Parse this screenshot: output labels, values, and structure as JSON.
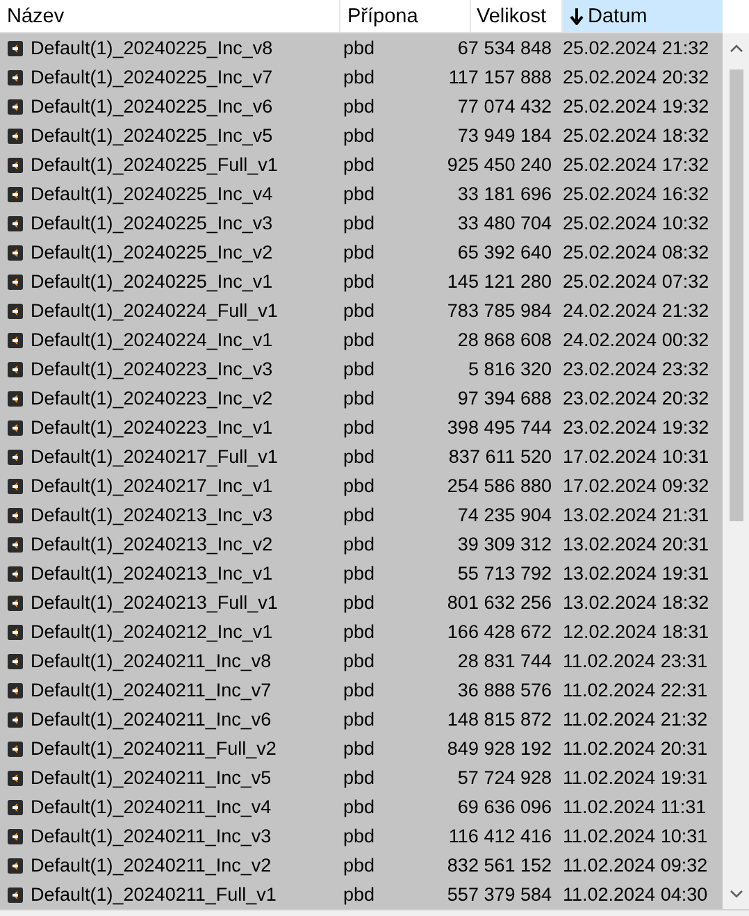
{
  "table": {
    "columns": [
      {
        "label": "Název",
        "sorted": false
      },
      {
        "label": "Přípona",
        "sorted": false
      },
      {
        "label": "Velikost",
        "sorted": false
      },
      {
        "label": "Datum",
        "sorted": true
      }
    ],
    "rows": [
      {
        "name": "Default(1)_20240225_Inc_v8",
        "ext": "pbd",
        "size": "67 534 848",
        "date": "25.02.2024 21:32",
        "selected": true
      },
      {
        "name": "Default(1)_20240225_Inc_v7",
        "ext": "pbd",
        "size": "117 157 888",
        "date": "25.02.2024 20:32",
        "selected": true
      },
      {
        "name": "Default(1)_20240225_Inc_v6",
        "ext": "pbd",
        "size": "77 074 432",
        "date": "25.02.2024 19:32",
        "selected": true
      },
      {
        "name": "Default(1)_20240225_Inc_v5",
        "ext": "pbd",
        "size": "73 949 184",
        "date": "25.02.2024 18:32",
        "selected": true
      },
      {
        "name": "Default(1)_20240225_Full_v1",
        "ext": "pbd",
        "size": "925 450 240",
        "date": "25.02.2024 17:32",
        "selected": true
      },
      {
        "name": "Default(1)_20240225_Inc_v4",
        "ext": "pbd",
        "size": "33 181 696",
        "date": "25.02.2024 16:32",
        "selected": true
      },
      {
        "name": "Default(1)_20240225_Inc_v3",
        "ext": "pbd",
        "size": "33 480 704",
        "date": "25.02.2024 10:32",
        "selected": true
      },
      {
        "name": "Default(1)_20240225_Inc_v2",
        "ext": "pbd",
        "size": "65 392 640",
        "date": "25.02.2024 08:32",
        "selected": true
      },
      {
        "name": "Default(1)_20240225_Inc_v1",
        "ext": "pbd",
        "size": "145 121 280",
        "date": "25.02.2024 07:32",
        "selected": true
      },
      {
        "name": "Default(1)_20240224_Full_v1",
        "ext": "pbd",
        "size": "783 785 984",
        "date": "24.02.2024 21:32",
        "selected": true
      },
      {
        "name": "Default(1)_20240224_Inc_v1",
        "ext": "pbd",
        "size": "28 868 608",
        "date": "24.02.2024 00:32",
        "selected": true
      },
      {
        "name": "Default(1)_20240223_Inc_v3",
        "ext": "pbd",
        "size": "5 816 320",
        "date": "23.02.2024 23:32",
        "selected": true
      },
      {
        "name": "Default(1)_20240223_Inc_v2",
        "ext": "pbd",
        "size": "97 394 688",
        "date": "23.02.2024 20:32",
        "selected": true
      },
      {
        "name": "Default(1)_20240223_Inc_v1",
        "ext": "pbd",
        "size": "398 495 744",
        "date": "23.02.2024 19:32",
        "selected": true
      },
      {
        "name": "Default(1)_20240217_Full_v1",
        "ext": "pbd",
        "size": "837 611 520",
        "date": "17.02.2024 10:31",
        "selected": true
      },
      {
        "name": "Default(1)_20240217_Inc_v1",
        "ext": "pbd",
        "size": "254 586 880",
        "date": "17.02.2024 09:32",
        "selected": true
      },
      {
        "name": "Default(1)_20240213_Inc_v3",
        "ext": "pbd",
        "size": "74 235 904",
        "date": "13.02.2024 21:31",
        "selected": true
      },
      {
        "name": "Default(1)_20240213_Inc_v2",
        "ext": "pbd",
        "size": "39 309 312",
        "date": "13.02.2024 20:31",
        "selected": true
      },
      {
        "name": "Default(1)_20240213_Inc_v1",
        "ext": "pbd",
        "size": "55 713 792",
        "date": "13.02.2024 19:31",
        "selected": true
      },
      {
        "name": "Default(1)_20240213_Full_v1",
        "ext": "pbd",
        "size": "801 632 256",
        "date": "13.02.2024 18:32",
        "selected": true
      },
      {
        "name": "Default(1)_20240212_Inc_v1",
        "ext": "pbd",
        "size": "166 428 672",
        "date": "12.02.2024 18:31",
        "selected": true
      },
      {
        "name": "Default(1)_20240211_Inc_v8",
        "ext": "pbd",
        "size": "28 831 744",
        "date": "11.02.2024 23:31",
        "selected": true
      },
      {
        "name": "Default(1)_20240211_Inc_v7",
        "ext": "pbd",
        "size": "36 888 576",
        "date": "11.02.2024 22:31",
        "selected": true
      },
      {
        "name": "Default(1)_20240211_Inc_v6",
        "ext": "pbd",
        "size": "148 815 872",
        "date": "11.02.2024 21:32",
        "selected": true
      },
      {
        "name": "Default(1)_20240211_Full_v2",
        "ext": "pbd",
        "size": "849 928 192",
        "date": "11.02.2024 20:31",
        "selected": true
      },
      {
        "name": "Default(1)_20240211_Inc_v5",
        "ext": "pbd",
        "size": "57 724 928",
        "date": "11.02.2024 19:31",
        "selected": true
      },
      {
        "name": "Default(1)_20240211_Inc_v4",
        "ext": "pbd",
        "size": "69 636 096",
        "date": "11.02.2024 11:31",
        "selected": true
      },
      {
        "name": "Default(1)_20240211_Inc_v3",
        "ext": "pbd",
        "size": "116 412 416",
        "date": "11.02.2024 10:31",
        "selected": true
      },
      {
        "name": "Default(1)_20240211_Inc_v2",
        "ext": "pbd",
        "size": "832 561 152",
        "date": "11.02.2024 09:32",
        "selected": true
      },
      {
        "name": "Default(1)_20240211_Full_v1",
        "ext": "pbd",
        "size": "557 379 584",
        "date": "11.02.2024 04:30",
        "selected": true
      }
    ]
  }
}
